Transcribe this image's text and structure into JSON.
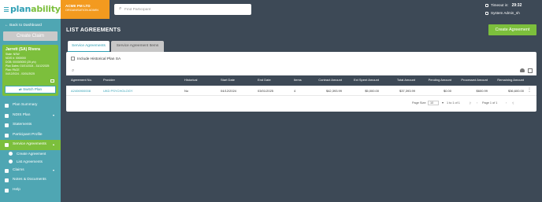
{
  "header": {
    "logo_part1": "plan",
    "logo_part2": "ability",
    "org_name": "ACME PM LTD",
    "org_role": "ORGANISATION ADMIN",
    "search_placeholder": "Find Participant",
    "timeout_label": "Timeout in:",
    "timeout_value": "29:32",
    "user": "System Admin_sh"
  },
  "sidebar": {
    "back_label": "Back to Dashboard",
    "create_claim_label": "Create Claim",
    "participant": {
      "name": "Jarrett (SA) Rivera",
      "lines": [
        "State: NSW",
        "NDIS #: 0000000",
        "DOB: 00/00/0000 (25 y/o)",
        "Plan Dates: 01/01/2024 - 31/12/2025",
        "Plan: PACE",
        "04/12/2024 - 03/01/2025"
      ],
      "switch_label": "Switch Plan"
    },
    "items": [
      {
        "label": "Plan Summary",
        "icon": "summary-icon"
      },
      {
        "label": "NDIS Plan",
        "icon": "ndis-icon",
        "caret": "▾"
      },
      {
        "label": "Statements",
        "icon": "statements-icon"
      },
      {
        "label": "Participant Profile",
        "icon": "profile-icon"
      },
      {
        "label": "Service Agreements",
        "icon": "agreements-icon",
        "caret": "▴",
        "active": true
      },
      {
        "label": "Claims",
        "icon": "claims-icon",
        "caret": "▾"
      },
      {
        "label": "Notes & Documents",
        "icon": "notes-icon"
      },
      {
        "label": "Help",
        "icon": "help-icon"
      }
    ],
    "sub_items": [
      "Create Agreement",
      "List Agreements"
    ]
  },
  "main": {
    "title": "LIST AGREEMENTS",
    "create_label": "Create Agreement",
    "tabs": [
      "Service Agreements",
      "Service Agreement Items"
    ],
    "include_historical_label": "Include Historical Plan SA",
    "columns": [
      "Agreement No.",
      "Provider",
      "Historical",
      "Start Date",
      "End Date",
      "Items",
      "Contract Amount",
      "Ext Spent Amount",
      "Total Amount",
      "Pending Amount",
      "Processed Amount",
      "Remaining Amount"
    ],
    "rows": [
      [
        "A2406900008",
        "UKD PSYCHOLOGY",
        "No",
        "04/12/2024",
        "03/01/2025",
        "4",
        "$42,393.99",
        "$5,000.00",
        "$37,393.99",
        "$0.00",
        "$600.99",
        "$36,600.00"
      ]
    ],
    "pager": {
      "page_size_label": "Page Size:",
      "page_size": "10",
      "range": "1 to 1 of 1",
      "page_text": "Page 1 of 1"
    }
  },
  "colors": {
    "accent": "#2e9fb4",
    "green": "#7cbf3c",
    "org": "#f39a1f",
    "dark": "#3d4956"
  }
}
